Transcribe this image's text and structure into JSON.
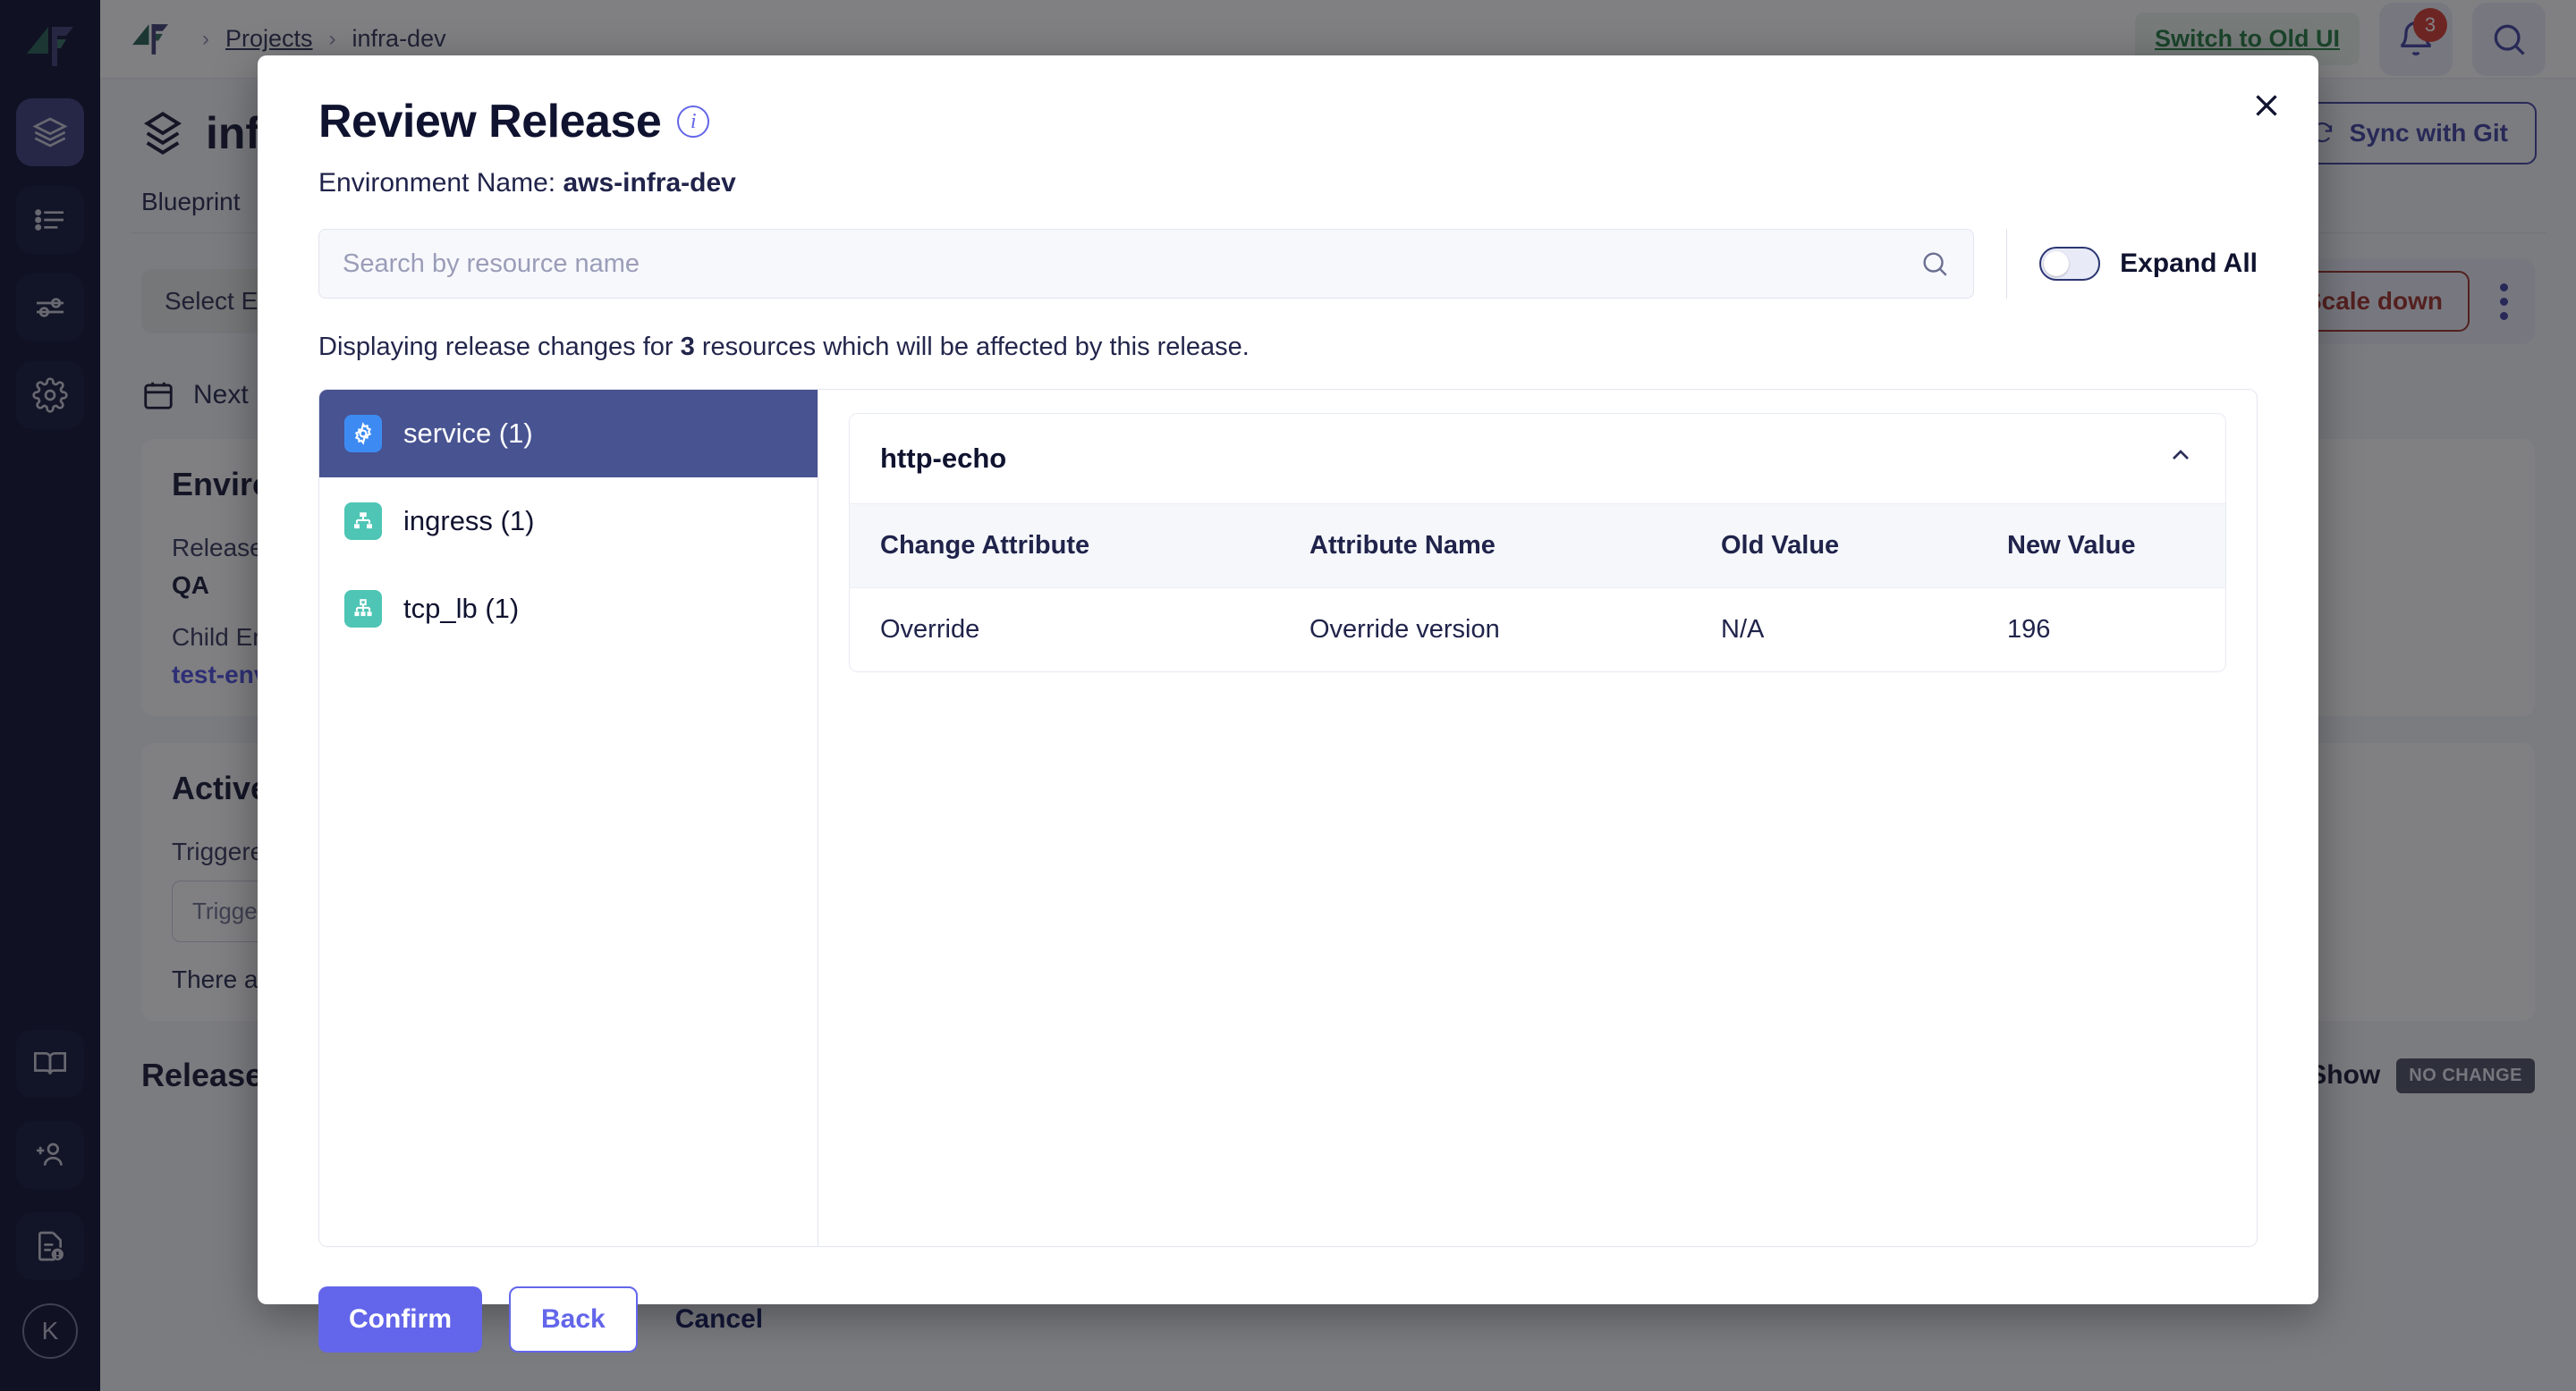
{
  "colors": {
    "accent": "#6366ea",
    "selected_row": "#485391",
    "service_icon": "#3d8bf2",
    "network_icon": "#4ec5b5",
    "danger": "#9c2b23",
    "success_link": "#1f7a3d",
    "rail_bg": "#080b2a"
  },
  "topbar": {
    "breadcrumb": {
      "projects": "Projects",
      "separator": "›",
      "current": "infra-dev"
    },
    "switch_ui_label": "Switch to Old UI",
    "notification_count": "3",
    "icons": {
      "bell": "bell-icon",
      "search": "search-icon"
    }
  },
  "rail": {
    "items": [
      {
        "name": "layers-icon",
        "active": true
      },
      {
        "name": "list-icon",
        "active": false
      },
      {
        "name": "sliders-icon",
        "active": false
      },
      {
        "name": "gear-icon",
        "active": false
      }
    ],
    "bottom_items": [
      {
        "name": "book-icon"
      },
      {
        "name": "add-user-icon"
      },
      {
        "name": "doc-alert-icon"
      }
    ],
    "avatar_initial": "K"
  },
  "page": {
    "title": "infra-dev",
    "sync_button": "Sync with Git",
    "tabs": [
      {
        "label": "Blueprint",
        "active": true
      }
    ],
    "select_env_label": "Select Environment",
    "scale_down_label": "Scale down",
    "next_release_label": "Next release",
    "env_card": {
      "heading": "Environment Details",
      "release_stage_label": "Release Stage",
      "release_stage_value": "QA",
      "child_env_label": "Child Environments",
      "child_env_value": "test-env"
    },
    "active_card": {
      "heading": "Active Release",
      "triggered_label": "Triggered By",
      "triggered_placeholder": "Triggered By",
      "empty_text": "There are no active releases."
    },
    "history": {
      "title": "Release History",
      "show_label": "Show",
      "chip_label": "NO CHANGE"
    }
  },
  "modal": {
    "title": "Review Release",
    "info_icon": "info-icon",
    "close_icon": "close-icon",
    "environment_label": "Environment Name:",
    "environment_name": "aws-infra-dev",
    "search_placeholder": "Search by resource name",
    "search_value": "",
    "search_icon": "search-icon",
    "expand_all_label": "Expand All",
    "expand_all_on": false,
    "summary_prefix": "Displaying release changes for",
    "summary_count": "3",
    "summary_suffix": "resources which will be affected by this release.",
    "resources": [
      {
        "label": "service (1)",
        "icon": "gear-icon",
        "icon_color": "blue",
        "selected": true
      },
      {
        "label": "ingress (1)",
        "icon": "sitemap-icon",
        "icon_color": "teal",
        "selected": false
      },
      {
        "label": "tcp_lb (1)",
        "icon": "sitemap-icon",
        "icon_color": "teal",
        "selected": false
      }
    ],
    "accordion": {
      "name": "http-echo",
      "expanded": true,
      "chevron_icon": "chevron-up-icon",
      "columns": [
        "Change Attribute",
        "Attribute Name",
        "Old Value",
        "New Value"
      ],
      "rows": [
        [
          "Override",
          "Override version",
          "N/A",
          "196"
        ]
      ]
    },
    "footer": {
      "confirm": "Confirm",
      "back": "Back",
      "cancel": "Cancel"
    }
  }
}
